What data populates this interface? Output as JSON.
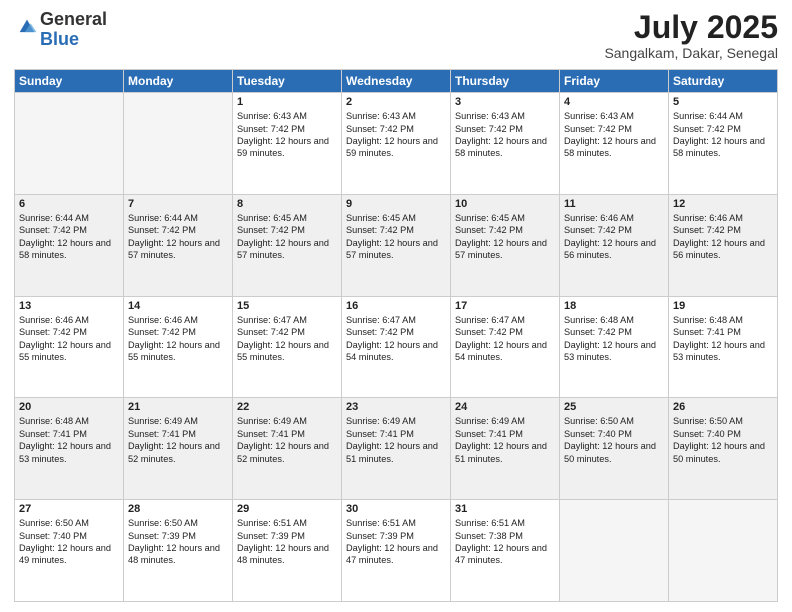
{
  "header": {
    "logo_general": "General",
    "logo_blue": "Blue",
    "title": "July 2025",
    "location": "Sangalkam, Dakar, Senegal"
  },
  "days_of_week": [
    "Sunday",
    "Monday",
    "Tuesday",
    "Wednesday",
    "Thursday",
    "Friday",
    "Saturday"
  ],
  "weeks": [
    [
      {
        "day": "",
        "sunrise": "",
        "sunset": "",
        "daylight": "",
        "empty": true
      },
      {
        "day": "",
        "sunrise": "",
        "sunset": "",
        "daylight": "",
        "empty": true
      },
      {
        "day": "1",
        "sunrise": "Sunrise: 6:43 AM",
        "sunset": "Sunset: 7:42 PM",
        "daylight": "Daylight: 12 hours and 59 minutes.",
        "empty": false
      },
      {
        "day": "2",
        "sunrise": "Sunrise: 6:43 AM",
        "sunset": "Sunset: 7:42 PM",
        "daylight": "Daylight: 12 hours and 59 minutes.",
        "empty": false
      },
      {
        "day": "3",
        "sunrise": "Sunrise: 6:43 AM",
        "sunset": "Sunset: 7:42 PM",
        "daylight": "Daylight: 12 hours and 58 minutes.",
        "empty": false
      },
      {
        "day": "4",
        "sunrise": "Sunrise: 6:43 AM",
        "sunset": "Sunset: 7:42 PM",
        "daylight": "Daylight: 12 hours and 58 minutes.",
        "empty": false
      },
      {
        "day": "5",
        "sunrise": "Sunrise: 6:44 AM",
        "sunset": "Sunset: 7:42 PM",
        "daylight": "Daylight: 12 hours and 58 minutes.",
        "empty": false
      }
    ],
    [
      {
        "day": "6",
        "sunrise": "Sunrise: 6:44 AM",
        "sunset": "Sunset: 7:42 PM",
        "daylight": "Daylight: 12 hours and 58 minutes.",
        "empty": false
      },
      {
        "day": "7",
        "sunrise": "Sunrise: 6:44 AM",
        "sunset": "Sunset: 7:42 PM",
        "daylight": "Daylight: 12 hours and 57 minutes.",
        "empty": false
      },
      {
        "day": "8",
        "sunrise": "Sunrise: 6:45 AM",
        "sunset": "Sunset: 7:42 PM",
        "daylight": "Daylight: 12 hours and 57 minutes.",
        "empty": false
      },
      {
        "day": "9",
        "sunrise": "Sunrise: 6:45 AM",
        "sunset": "Sunset: 7:42 PM",
        "daylight": "Daylight: 12 hours and 57 minutes.",
        "empty": false
      },
      {
        "day": "10",
        "sunrise": "Sunrise: 6:45 AM",
        "sunset": "Sunset: 7:42 PM",
        "daylight": "Daylight: 12 hours and 57 minutes.",
        "empty": false
      },
      {
        "day": "11",
        "sunrise": "Sunrise: 6:46 AM",
        "sunset": "Sunset: 7:42 PM",
        "daylight": "Daylight: 12 hours and 56 minutes.",
        "empty": false
      },
      {
        "day": "12",
        "sunrise": "Sunrise: 6:46 AM",
        "sunset": "Sunset: 7:42 PM",
        "daylight": "Daylight: 12 hours and 56 minutes.",
        "empty": false
      }
    ],
    [
      {
        "day": "13",
        "sunrise": "Sunrise: 6:46 AM",
        "sunset": "Sunset: 7:42 PM",
        "daylight": "Daylight: 12 hours and 55 minutes.",
        "empty": false
      },
      {
        "day": "14",
        "sunrise": "Sunrise: 6:46 AM",
        "sunset": "Sunset: 7:42 PM",
        "daylight": "Daylight: 12 hours and 55 minutes.",
        "empty": false
      },
      {
        "day": "15",
        "sunrise": "Sunrise: 6:47 AM",
        "sunset": "Sunset: 7:42 PM",
        "daylight": "Daylight: 12 hours and 55 minutes.",
        "empty": false
      },
      {
        "day": "16",
        "sunrise": "Sunrise: 6:47 AM",
        "sunset": "Sunset: 7:42 PM",
        "daylight": "Daylight: 12 hours and 54 minutes.",
        "empty": false
      },
      {
        "day": "17",
        "sunrise": "Sunrise: 6:47 AM",
        "sunset": "Sunset: 7:42 PM",
        "daylight": "Daylight: 12 hours and 54 minutes.",
        "empty": false
      },
      {
        "day": "18",
        "sunrise": "Sunrise: 6:48 AM",
        "sunset": "Sunset: 7:42 PM",
        "daylight": "Daylight: 12 hours and 53 minutes.",
        "empty": false
      },
      {
        "day": "19",
        "sunrise": "Sunrise: 6:48 AM",
        "sunset": "Sunset: 7:41 PM",
        "daylight": "Daylight: 12 hours and 53 minutes.",
        "empty": false
      }
    ],
    [
      {
        "day": "20",
        "sunrise": "Sunrise: 6:48 AM",
        "sunset": "Sunset: 7:41 PM",
        "daylight": "Daylight: 12 hours and 53 minutes.",
        "empty": false
      },
      {
        "day": "21",
        "sunrise": "Sunrise: 6:49 AM",
        "sunset": "Sunset: 7:41 PM",
        "daylight": "Daylight: 12 hours and 52 minutes.",
        "empty": false
      },
      {
        "day": "22",
        "sunrise": "Sunrise: 6:49 AM",
        "sunset": "Sunset: 7:41 PM",
        "daylight": "Daylight: 12 hours and 52 minutes.",
        "empty": false
      },
      {
        "day": "23",
        "sunrise": "Sunrise: 6:49 AM",
        "sunset": "Sunset: 7:41 PM",
        "daylight": "Daylight: 12 hours and 51 minutes.",
        "empty": false
      },
      {
        "day": "24",
        "sunrise": "Sunrise: 6:49 AM",
        "sunset": "Sunset: 7:41 PM",
        "daylight": "Daylight: 12 hours and 51 minutes.",
        "empty": false
      },
      {
        "day": "25",
        "sunrise": "Sunrise: 6:50 AM",
        "sunset": "Sunset: 7:40 PM",
        "daylight": "Daylight: 12 hours and 50 minutes.",
        "empty": false
      },
      {
        "day": "26",
        "sunrise": "Sunrise: 6:50 AM",
        "sunset": "Sunset: 7:40 PM",
        "daylight": "Daylight: 12 hours and 50 minutes.",
        "empty": false
      }
    ],
    [
      {
        "day": "27",
        "sunrise": "Sunrise: 6:50 AM",
        "sunset": "Sunset: 7:40 PM",
        "daylight": "Daylight: 12 hours and 49 minutes.",
        "empty": false
      },
      {
        "day": "28",
        "sunrise": "Sunrise: 6:50 AM",
        "sunset": "Sunset: 7:39 PM",
        "daylight": "Daylight: 12 hours and 48 minutes.",
        "empty": false
      },
      {
        "day": "29",
        "sunrise": "Sunrise: 6:51 AM",
        "sunset": "Sunset: 7:39 PM",
        "daylight": "Daylight: 12 hours and 48 minutes.",
        "empty": false
      },
      {
        "day": "30",
        "sunrise": "Sunrise: 6:51 AM",
        "sunset": "Sunset: 7:39 PM",
        "daylight": "Daylight: 12 hours and 47 minutes.",
        "empty": false
      },
      {
        "day": "31",
        "sunrise": "Sunrise: 6:51 AM",
        "sunset": "Sunset: 7:38 PM",
        "daylight": "Daylight: 12 hours and 47 minutes.",
        "empty": false
      },
      {
        "day": "",
        "sunrise": "",
        "sunset": "",
        "daylight": "",
        "empty": true
      },
      {
        "day": "",
        "sunrise": "",
        "sunset": "",
        "daylight": "",
        "empty": true
      }
    ]
  ]
}
